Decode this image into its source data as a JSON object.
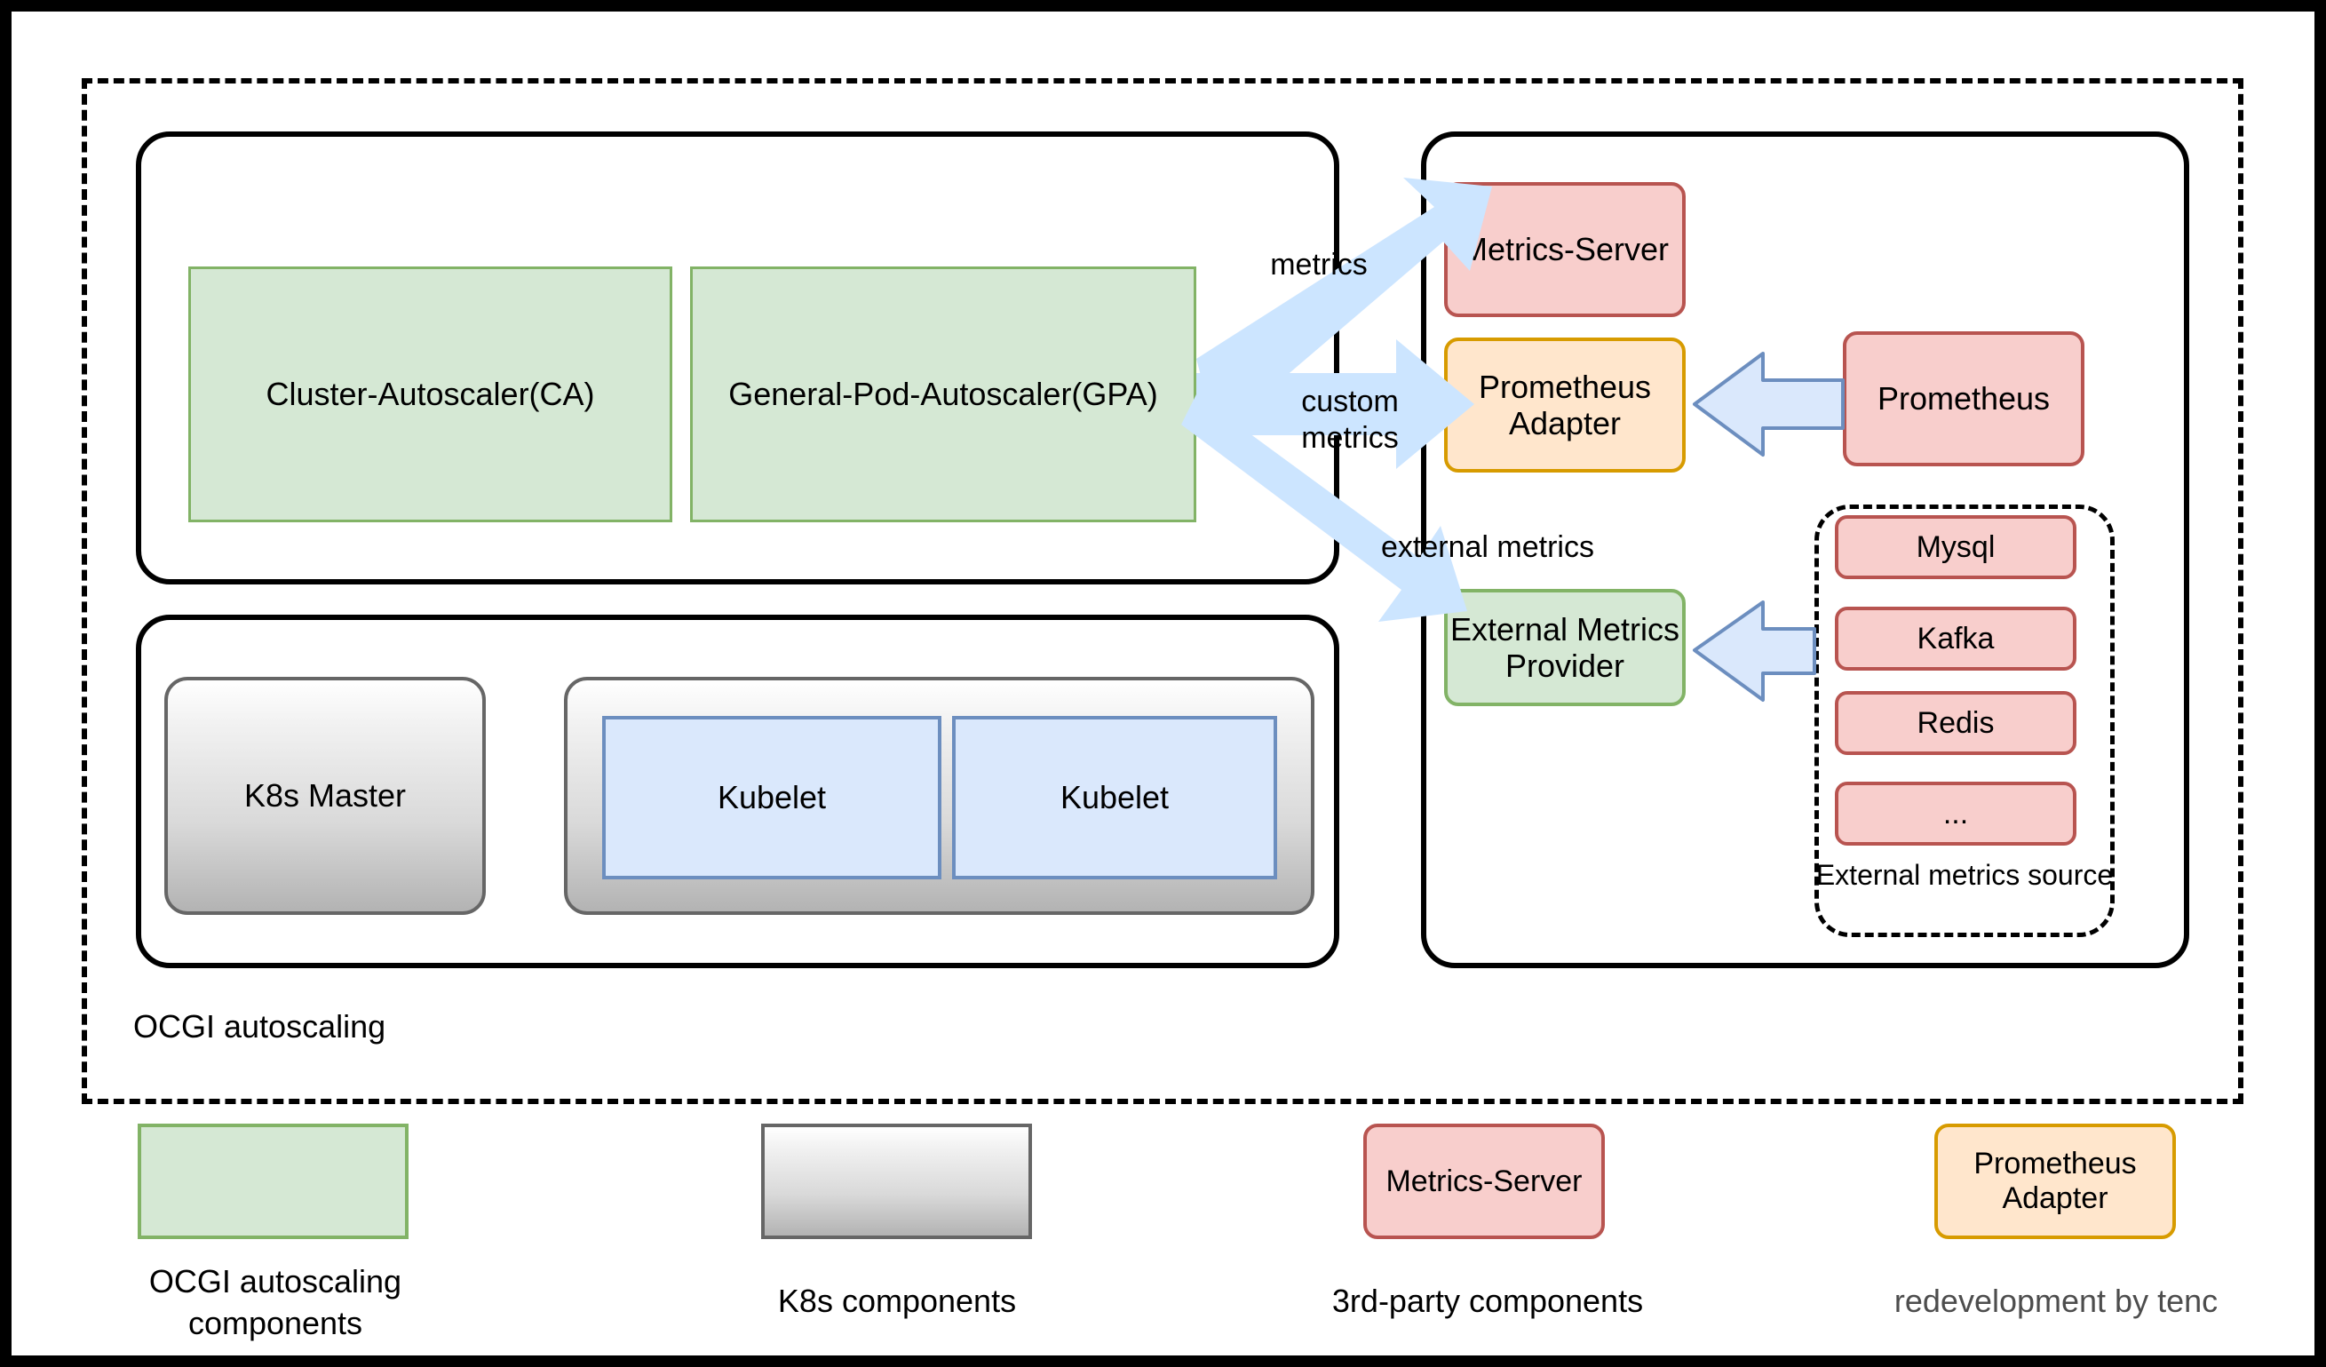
{
  "diagram": {
    "boundary_label": "OCGI autoscaling",
    "autoscaling_components": [
      {
        "label": "Cluster-Autoscaler(CA)"
      },
      {
        "label": "General-Pod-Autoscaler(GPA)"
      }
    ],
    "k8s_components": [
      {
        "label": "K8s Master"
      },
      {
        "label": "Kubelet"
      },
      {
        "label": "Kubelet"
      }
    ],
    "metrics_providers": [
      {
        "label": "Metrics-Server"
      },
      {
        "label": "Prometheus\nAdapter"
      },
      {
        "label": "External Metrics\nProvider"
      }
    ],
    "third_party": [
      {
        "label": "Prometheus"
      }
    ],
    "external_metrics_source": {
      "caption": "External metrics\nsource",
      "items": [
        {
          "label": "Mysql"
        },
        {
          "label": "Kafka"
        },
        {
          "label": "Redis"
        },
        {
          "label": "..."
        }
      ]
    },
    "edge_labels": {
      "metrics": "metrics",
      "custom_metrics": "custom\nmetrics",
      "external_metrics": "external metrics"
    }
  },
  "legend": {
    "items": [
      {
        "swatch_text": "",
        "caption": "OCGI autoscaling\ncomponents"
      },
      {
        "swatch_text": "",
        "caption": "K8s components"
      },
      {
        "swatch_text": "Metrics-Server",
        "caption": "3rd-party components"
      },
      {
        "swatch_text": "Prometheus\nAdapter",
        "caption": "redevelopment by tenc"
      }
    ]
  },
  "colors": {
    "green_fill": "#d5e8d4",
    "green_stroke": "#82b366",
    "pink_fill": "#f8cecc",
    "pink_stroke": "#b85450",
    "orange_fill": "#ffe6cc",
    "orange_stroke": "#d79b00",
    "blue_fill": "#dae8fc",
    "blue_stroke": "#6c8ebf",
    "arrow_fill": "#cce5ff",
    "gray_stroke": "#666666",
    "legend_muted_text": "#4d4d4d"
  }
}
